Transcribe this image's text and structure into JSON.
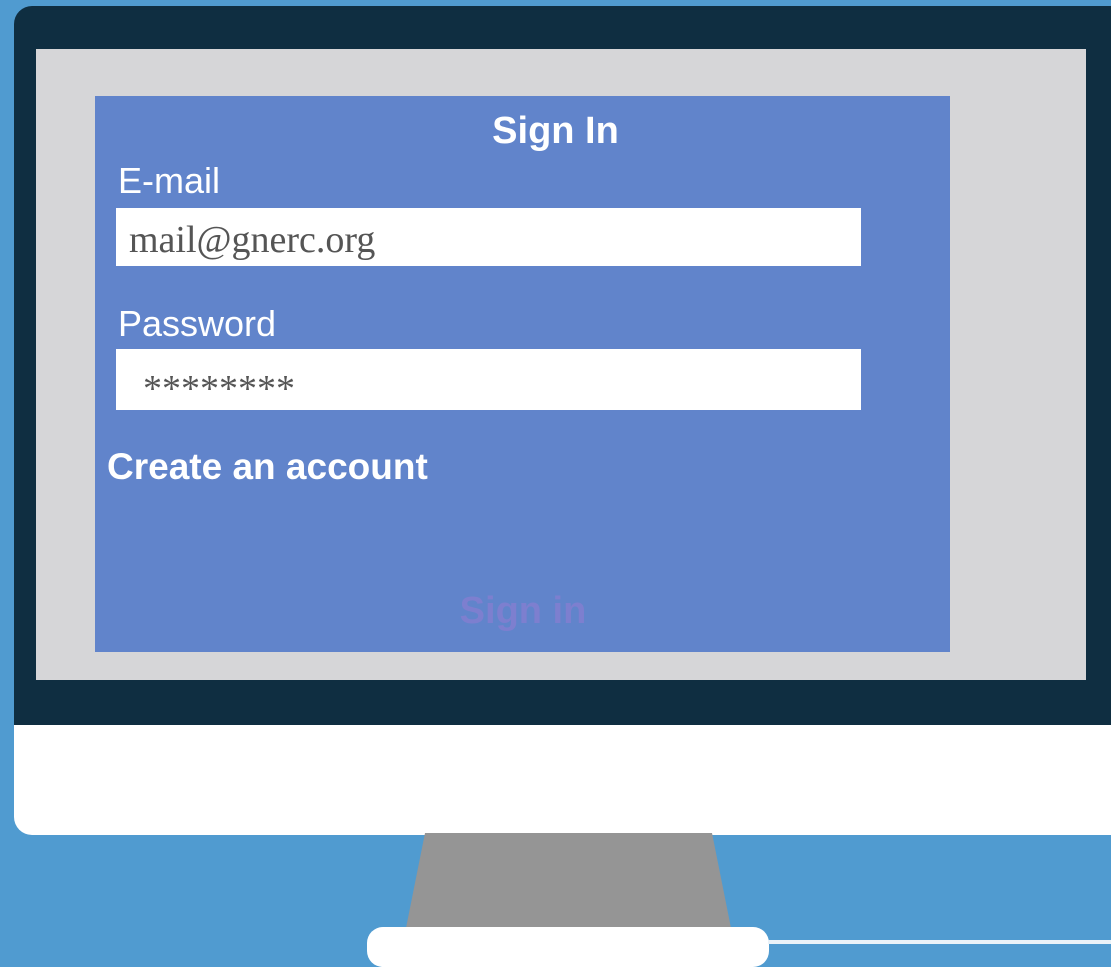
{
  "form": {
    "title": "Sign In",
    "email_label": "E-mail",
    "email_value": "mail@gnerc.org",
    "password_label": "Password",
    "password_value": "********",
    "create_account_label": "Create an account",
    "sign_in_button_label": "Sign in"
  },
  "colors": {
    "background": "#509bd0",
    "bezel": "#0f2e41",
    "screen": "#d6d6d8",
    "panel": "#6184cb",
    "stand": "#959595",
    "sign_in_button_text": "#7d7fcf"
  }
}
